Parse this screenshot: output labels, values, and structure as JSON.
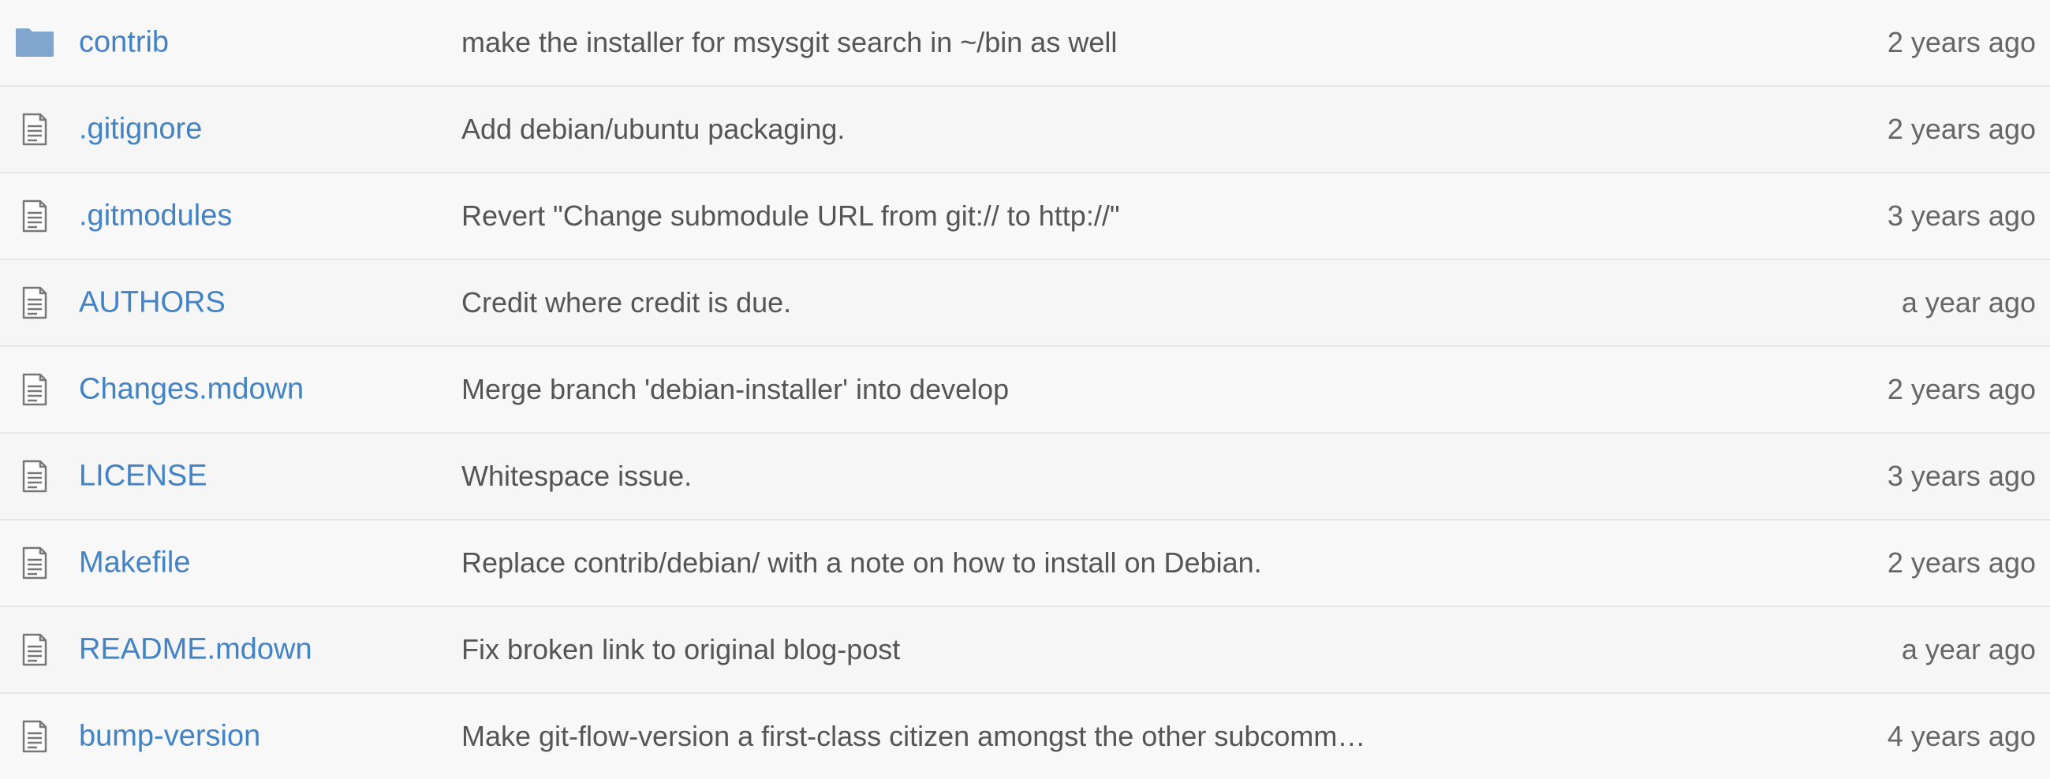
{
  "colors": {
    "link": "#4183c4",
    "message": "#555555",
    "age": "#666666",
    "folder_icon": "#80a6cd",
    "file_icon": "#777777",
    "row_border": "#e5e5e5",
    "row_background": "#f8f8f8"
  },
  "files": [
    {
      "icon": "folder-icon",
      "name": "contrib",
      "message": "make the installer for msysgit search in ~/bin as well",
      "age": "2 years ago"
    },
    {
      "icon": "file-icon",
      "name": ".gitignore",
      "message": "Add debian/ubuntu packaging.",
      "age": "2 years ago"
    },
    {
      "icon": "file-icon",
      "name": ".gitmodules",
      "message": "Revert \"Change submodule URL from git:// to http://\"",
      "age": "3 years ago"
    },
    {
      "icon": "file-icon",
      "name": "AUTHORS",
      "message": "Credit where credit is due.",
      "age": "a year ago"
    },
    {
      "icon": "file-icon",
      "name": "Changes.mdown",
      "message": "Merge branch 'debian-installer' into develop",
      "age": "2 years ago"
    },
    {
      "icon": "file-icon",
      "name": "LICENSE",
      "message": "Whitespace issue.",
      "age": "3 years ago"
    },
    {
      "icon": "file-icon",
      "name": "Makefile",
      "message": "Replace contrib/debian/ with a note on how to install on Debian.",
      "age": "2 years ago"
    },
    {
      "icon": "file-icon",
      "name": "README.mdown",
      "message": "Fix broken link to original blog-post",
      "age": "a year ago"
    },
    {
      "icon": "file-icon",
      "name": "bump-version",
      "message": "Make git-flow-version a first-class citizen amongst the other subcomm…",
      "age": "4 years ago"
    }
  ]
}
